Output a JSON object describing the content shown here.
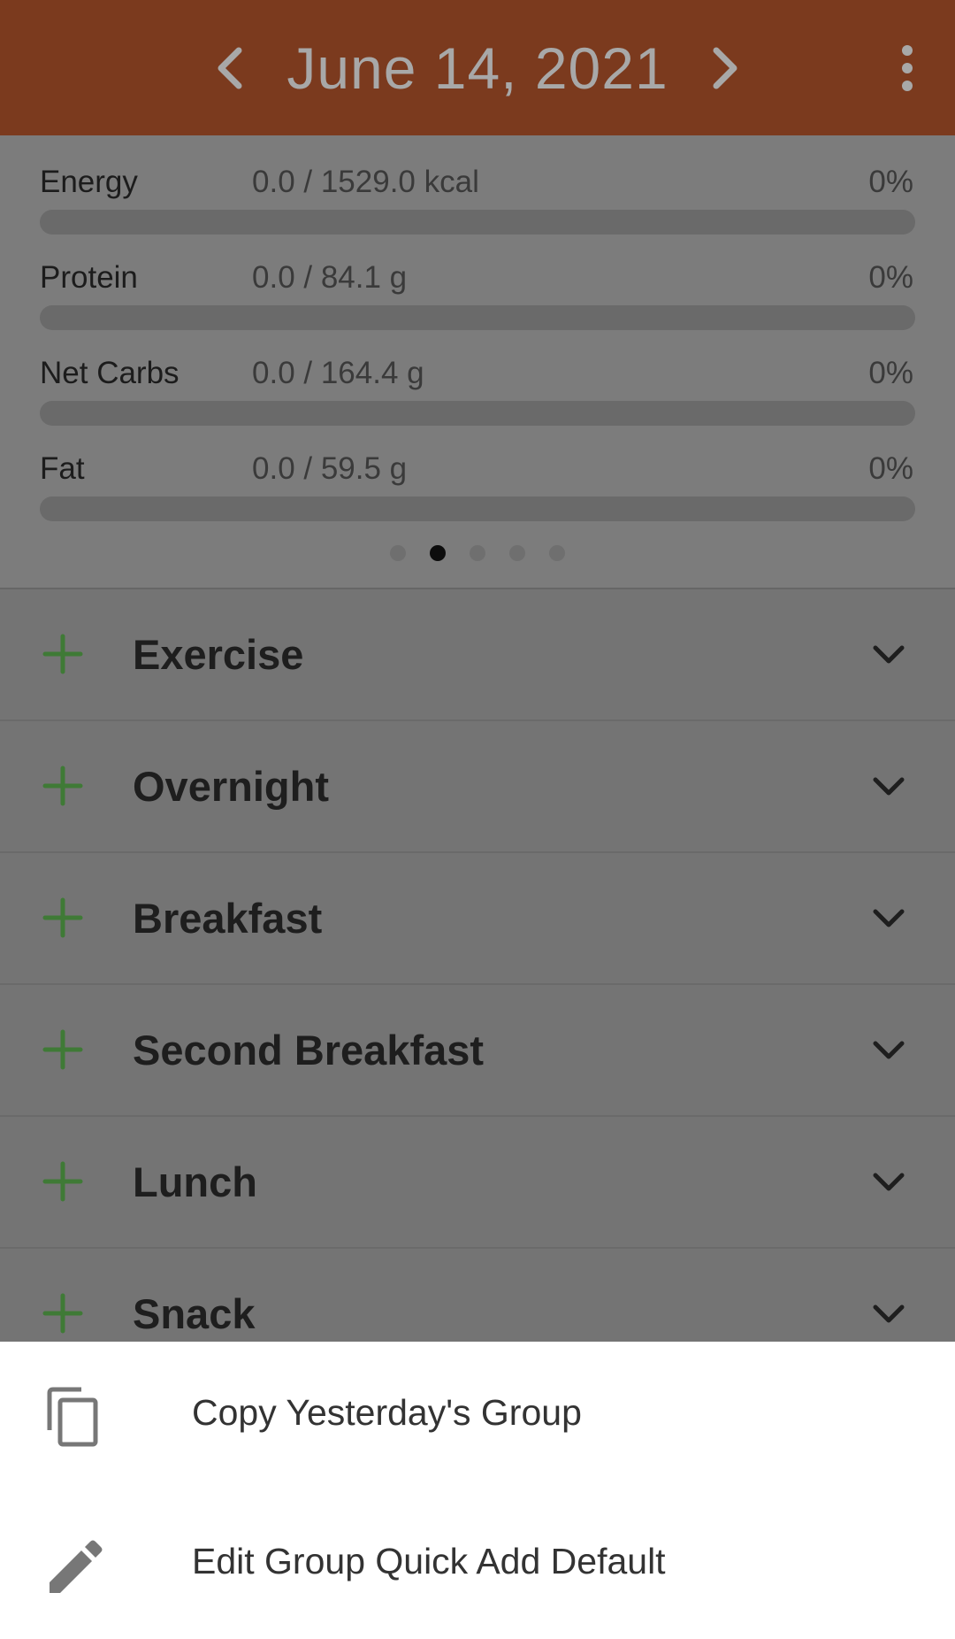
{
  "header": {
    "date": "June 14, 2021",
    "prev_icon": "chevron-left-icon",
    "next_icon": "chevron-right-icon",
    "menu_icon": "more-vertical-icon",
    "color": "#7b3a1e"
  },
  "summary": {
    "nutrients": [
      {
        "name": "Energy",
        "amount": "0.0 / 1529.0 kcal",
        "percent": "0%",
        "progress": 0
      },
      {
        "name": "Protein",
        "amount": "0.0 / 84.1 g",
        "percent": "0%",
        "progress": 0
      },
      {
        "name": "Net Carbs",
        "amount": "0.0 / 164.4 g",
        "percent": "0%",
        "progress": 0
      },
      {
        "name": "Fat",
        "amount": "0.0 / 59.5 g",
        "percent": "0%",
        "progress": 0
      }
    ],
    "pager": {
      "count": 5,
      "active_index": 1
    }
  },
  "groups": [
    {
      "label": "Exercise"
    },
    {
      "label": "Overnight"
    },
    {
      "label": "Breakfast"
    },
    {
      "label": "Second Breakfast"
    },
    {
      "label": "Lunch"
    },
    {
      "label": "Snack"
    }
  ],
  "bottom_sheet": {
    "items": [
      {
        "label": "Copy Yesterday's Group",
        "icon": "copy-icon"
      },
      {
        "label": "Edit Group Quick Add Default",
        "icon": "pencil-icon"
      }
    ]
  },
  "colors": {
    "accent_green": "#3f7a36",
    "scrim_gray": "#747474"
  }
}
